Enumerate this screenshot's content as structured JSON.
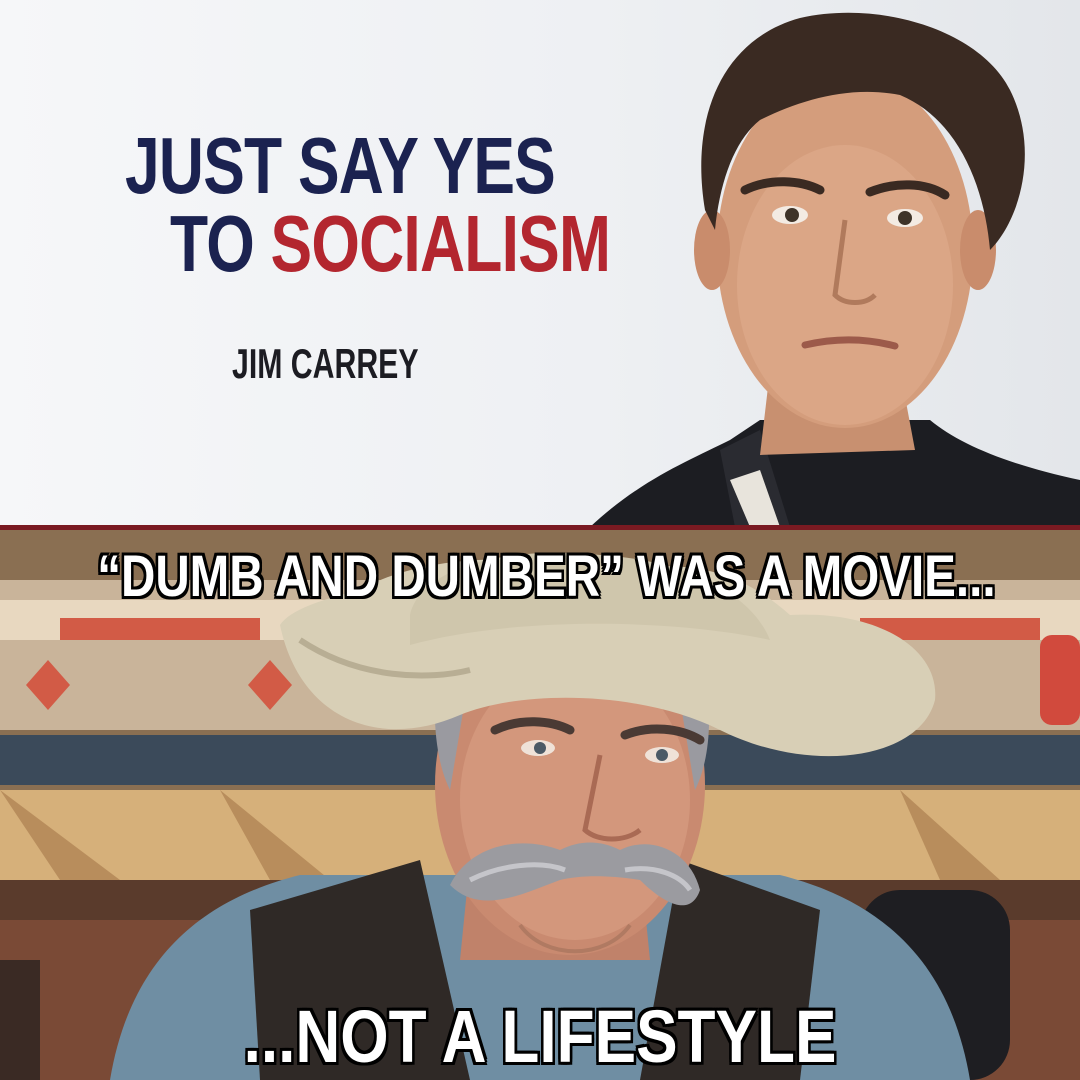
{
  "top_panel": {
    "headline": {
      "line1": "JUST SAY YES",
      "line2_prefix": "TO ",
      "line2_emphasis": "SOCIALISM"
    },
    "attribution": "JIM CARREY",
    "colors": {
      "navy": "#1b2250",
      "red": "#b3262f",
      "attribution": "#1c1c22"
    }
  },
  "bottom_panel": {
    "caption_top": "“DUMB AND DUMBER” WAS A MOVIE...",
    "caption_bottom": "...NOT A LIFESTYLE",
    "colors": {
      "caption_fill": "#ffffff",
      "caption_outline": "#000000"
    }
  },
  "divider": {
    "color": "#7a1a22"
  }
}
